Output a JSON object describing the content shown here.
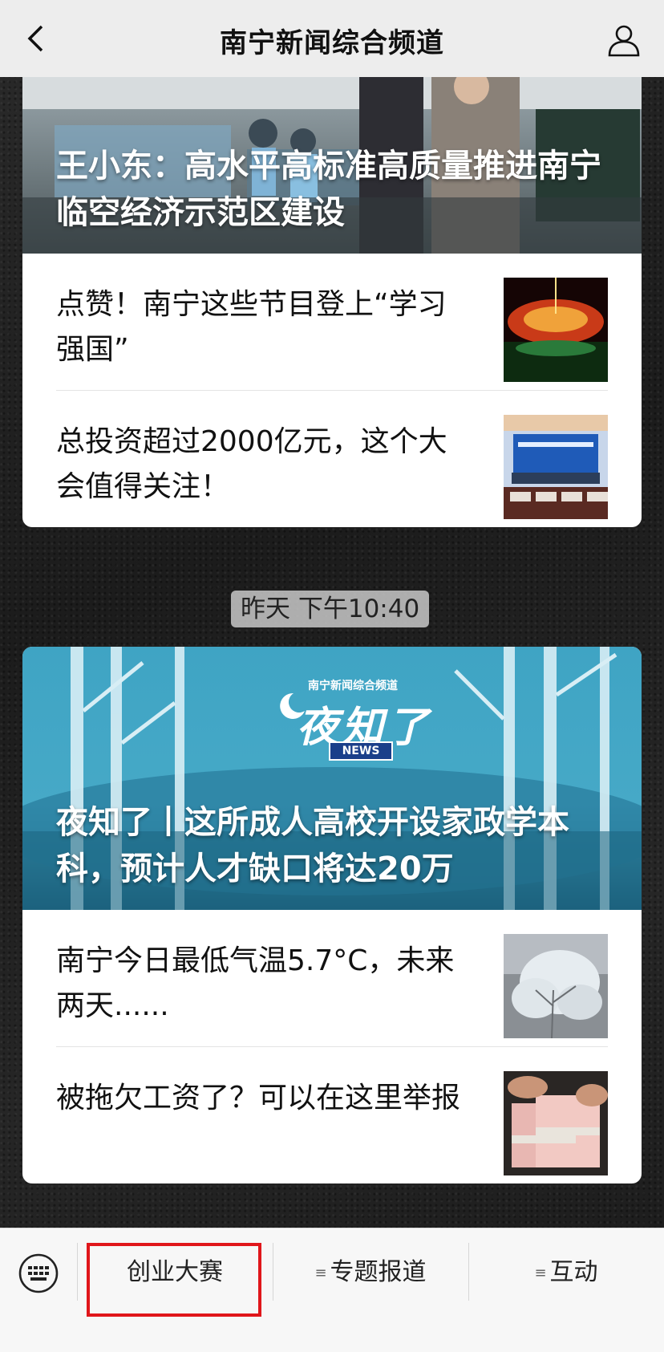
{
  "nav": {
    "title": "南宁新闻综合频道",
    "back_icon": "chevron-left-icon",
    "user_icon": "person-icon"
  },
  "feed1": {
    "hero_title": "王小东：高水平高标准高质量推进南宁临空经济示范区建设",
    "items": [
      {
        "title": "点赞！南宁这些节目登上“学习强国”",
        "thumb": "stage-fireworks-photo"
      },
      {
        "title": "总投资超过2000亿元，这个大会值得关注！",
        "thumb": "press-conference-photo"
      }
    ]
  },
  "timestamp": "昨天 下午10:40",
  "feed2": {
    "hero_channel": "南宁新闻综合频道",
    "hero_logo_text": "夜知了",
    "hero_logo_badge": "NEWS",
    "hero_title": "夜知了丨这所成人高校开设家政学本科，预计人才缺口将达20万",
    "items": [
      {
        "title": "南宁今日最低气温5.7°C，未来两天......",
        "thumb": "frost-tree-photo"
      },
      {
        "title": "被拖欠工资了？可以在这里举报",
        "thumb": "cash-bundles-photo"
      }
    ]
  },
  "bottom_menu": {
    "keyboard_icon": "keyboard-icon",
    "items": [
      {
        "label": "创业大赛"
      },
      {
        "label": "专题报道"
      },
      {
        "label": "互动"
      }
    ],
    "highlight_color": "#e0161b"
  }
}
